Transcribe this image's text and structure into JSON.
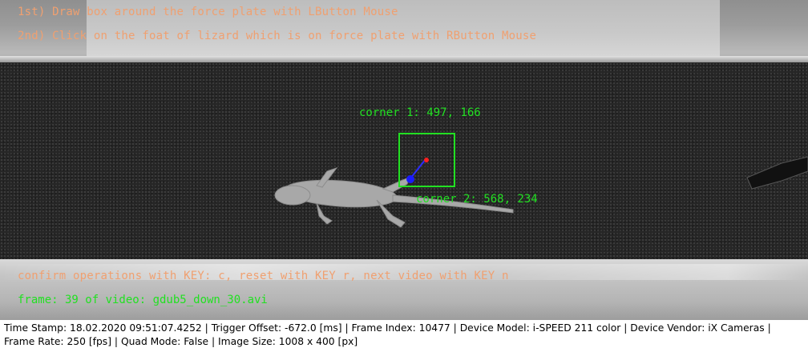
{
  "overlay": {
    "instruction_1": "1st) Draw box around the force plate with LButton Mouse",
    "instruction_2": "2nd) Click on the foat of lizard which is on force plate with RButton Mouse",
    "instruction_3": "confirm operations with KEY: c, reset with KEY r, next video with KEY n",
    "corner1": "corner 1: 497, 166",
    "corner2": "corner 2: 568, 234",
    "frame_info": "frame: 39 of video: gdub5_down_30.avi",
    "colors": {
      "instruction": "#f0a070",
      "box": "#22e022",
      "foot_marker": "#ff2020",
      "center_marker": "#1a1aff"
    }
  },
  "status": {
    "line_1": "Time Stamp: 18.02.2020 09:51:07.4252  |  Trigger Offset: -672.0 [ms]  |  Frame Index: 10477  |  Device Model: i-SPEED 211 color  |  Device Vendor: iX Cameras  |",
    "line_2": "Frame Rate: 250 [fps]  |  Quad Mode: False  |  Image Size: 1008 x 400 [px]"
  }
}
